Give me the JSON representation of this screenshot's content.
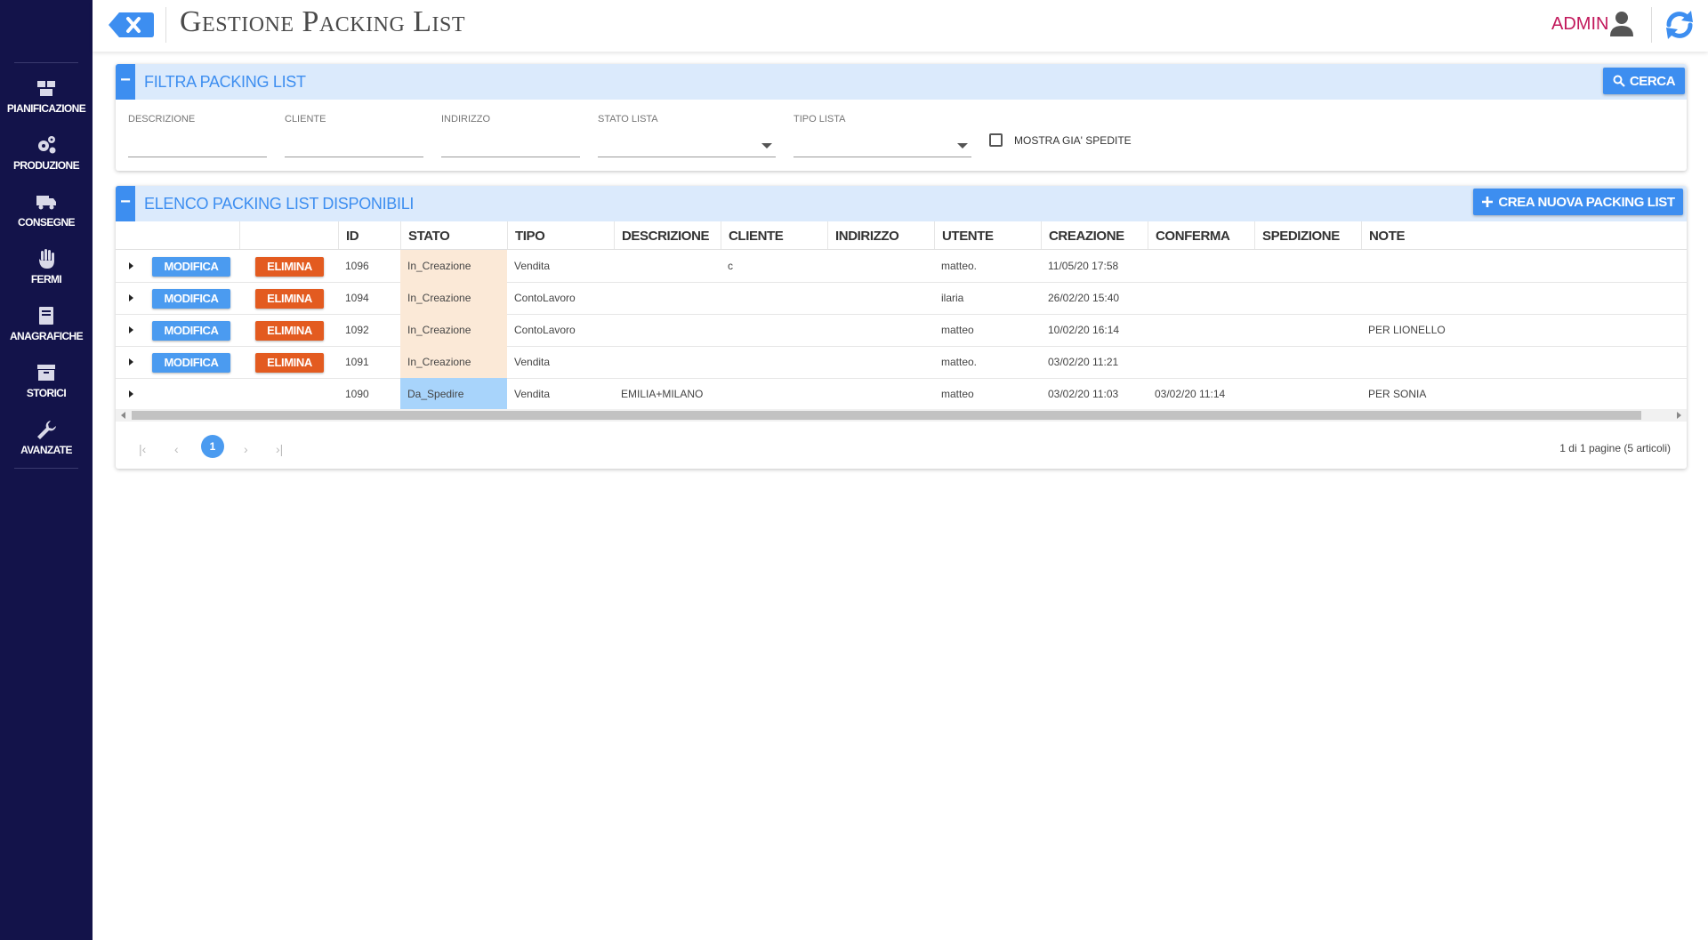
{
  "header": {
    "title": "Gestione Packing List",
    "user": "ADMIN"
  },
  "sidebar": {
    "items": [
      {
        "label": "PIANIFICAZIONE",
        "icon": "boxes-icon"
      },
      {
        "label": "PRODUZIONE",
        "icon": "gears-icon"
      },
      {
        "label": "CONSEGNE",
        "icon": "truck-icon"
      },
      {
        "label": "FERMI",
        "icon": "hand-icon"
      },
      {
        "label": "ANAGRAFICHE",
        "icon": "book-icon"
      },
      {
        "label": "STORICI",
        "icon": "archive-icon"
      },
      {
        "label": "AVANZATE",
        "icon": "wrench-icon"
      }
    ]
  },
  "filter": {
    "title": "FILTRA PACKING LIST",
    "search_label": "CERCA",
    "fields": {
      "descrizione": {
        "label": "DESCRIZIONE",
        "value": ""
      },
      "cliente": {
        "label": "CLIENTE",
        "value": ""
      },
      "indirizzo": {
        "label": "INDIRIZZO",
        "value": ""
      },
      "stato_lista": {
        "label": "STATO LISTA",
        "value": ""
      },
      "tipo_lista": {
        "label": "TIPO LISTA",
        "value": ""
      }
    },
    "checkbox_label": "MOSTRA GIA' SPEDITE"
  },
  "list": {
    "title": "ELENCO PACKING LIST DISPONIBILI",
    "create_label": "CREA NUOVA PACKING LIST",
    "columns": {
      "id": "ID",
      "stato": "STATO",
      "tipo": "TIPO",
      "descrizione": "DESCRIZIONE",
      "cliente": "CLIENTE",
      "indirizzo": "INDIRIZZO",
      "utente": "UTENTE",
      "creazione": "CREAZIONE",
      "conferma": "CONFERMA",
      "spedizione": "SPEDIZIONE",
      "note": "NOTE"
    },
    "modify_label": "MODIFICA",
    "delete_label": "ELIMINA",
    "rows": [
      {
        "id": "1096",
        "stato": "In_Creazione",
        "tipo": "Vendita",
        "descrizione": "",
        "cliente": "c",
        "indirizzo": "",
        "utente": "matteo.",
        "creazione": "11/05/20 17:58",
        "conferma": "",
        "spedizione": "",
        "note": "",
        "editable": true
      },
      {
        "id": "1094",
        "stato": "In_Creazione",
        "tipo": "ContoLavoro",
        "descrizione": "",
        "cliente": "",
        "indirizzo": "",
        "utente": "ilaria",
        "creazione": "26/02/20 15:40",
        "conferma": "",
        "spedizione": "",
        "note": "",
        "editable": true
      },
      {
        "id": "1092",
        "stato": "In_Creazione",
        "tipo": "ContoLavoro",
        "descrizione": "",
        "cliente": "",
        "indirizzo": "",
        "utente": "matteo",
        "creazione": "10/02/20 16:14",
        "conferma": "",
        "spedizione": "",
        "note": "PER LIONELLO",
        "editable": true
      },
      {
        "id": "1091",
        "stato": "In_Creazione",
        "tipo": "Vendita",
        "descrizione": "",
        "cliente": "",
        "indirizzo": "",
        "utente": "matteo.",
        "creazione": "03/02/20 11:21",
        "conferma": "",
        "spedizione": "",
        "note": "",
        "editable": true
      },
      {
        "id": "1090",
        "stato": "Da_Spedire",
        "tipo": "Vendita",
        "descrizione": "EMILIA+MILANO",
        "cliente": "",
        "indirizzo": "",
        "utente": "matteo",
        "creazione": "03/02/20 11:03",
        "conferma": "03/02/20 11:14",
        "spedizione": "",
        "note": "PER SONIA",
        "editable": false
      }
    ],
    "pager": {
      "current_page": "1",
      "info": "1 di 1 pagine (5 articoli)"
    }
  },
  "colors": {
    "sidebar": "#13134a",
    "accent": "#3d8ef0",
    "delete": "#e35b20",
    "stato_creazione": "#fbe9d7",
    "stato_spedire": "#a8d4fb",
    "admin": "#c2185b"
  }
}
